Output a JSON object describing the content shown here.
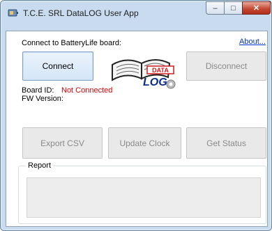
{
  "window": {
    "title": "T.C.E. SRL DataLOG User App",
    "minimize_glyph": "–",
    "maximize_glyph": "□",
    "close_glyph": "✕"
  },
  "connect_section": {
    "prompt": "Connect to BatteryLife board:",
    "about_link": "About...",
    "connect_label": "Connect",
    "disconnect_label": "Disconnect"
  },
  "logo": {
    "word1": "DATA",
    "word2": "LOG"
  },
  "board_info": {
    "board_id_label": "Board ID:",
    "board_id_value": "Not Connected",
    "fw_version_label": "FW Version:"
  },
  "actions": {
    "export_label": "Export CSV",
    "update_clock_label": "Update Clock",
    "get_status_label": "Get Status"
  },
  "report": {
    "legend": "Report"
  },
  "colors": {
    "status_error": "#e00000",
    "link": "#0033cc",
    "logo_red": "#d11a1a",
    "logo_blue": "#0b2f8a"
  }
}
